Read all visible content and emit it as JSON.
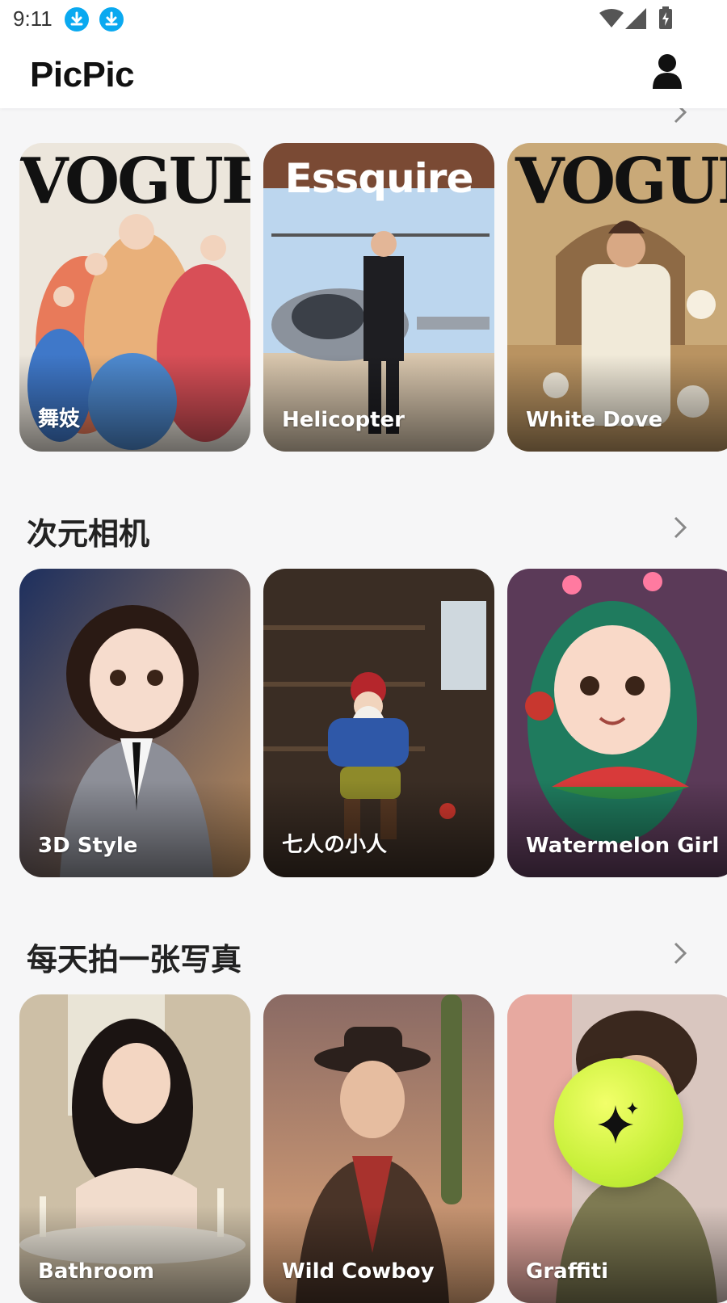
{
  "status_bar": {
    "time": "9:11",
    "icons": [
      "download-icon",
      "download-icon",
      "wifi-icon",
      "signal-icon",
      "battery-charging-icon"
    ]
  },
  "header": {
    "title": "PicPic",
    "profile_icon": "person-icon"
  },
  "sections": [
    {
      "title": "",
      "more_icon": "chevron-right-icon",
      "cards": [
        {
          "label": "舞妓",
          "cover_text": "VOGUE"
        },
        {
          "label": "Helicopter",
          "cover_text": "Essquire"
        },
        {
          "label": "White Dove",
          "cover_text": "VOGUE"
        }
      ]
    },
    {
      "title": "次元相机",
      "more_icon": "chevron-right-icon",
      "cards": [
        {
          "label": "3D Style"
        },
        {
          "label": "七人の小人"
        },
        {
          "label": "Watermelon Girl"
        }
      ]
    },
    {
      "title": "每天拍一张写真",
      "more_icon": "chevron-right-icon",
      "cards": [
        {
          "label": "Bathroom"
        },
        {
          "label": "Wild Cowboy"
        },
        {
          "label": "Graffiti"
        }
      ]
    }
  ],
  "fab": {
    "icon": "sparkle-icon"
  },
  "colors": {
    "accent_fab": "#c8f03a",
    "download_badge": "#0aa9f0",
    "page_bg": "#f6f6f7"
  }
}
